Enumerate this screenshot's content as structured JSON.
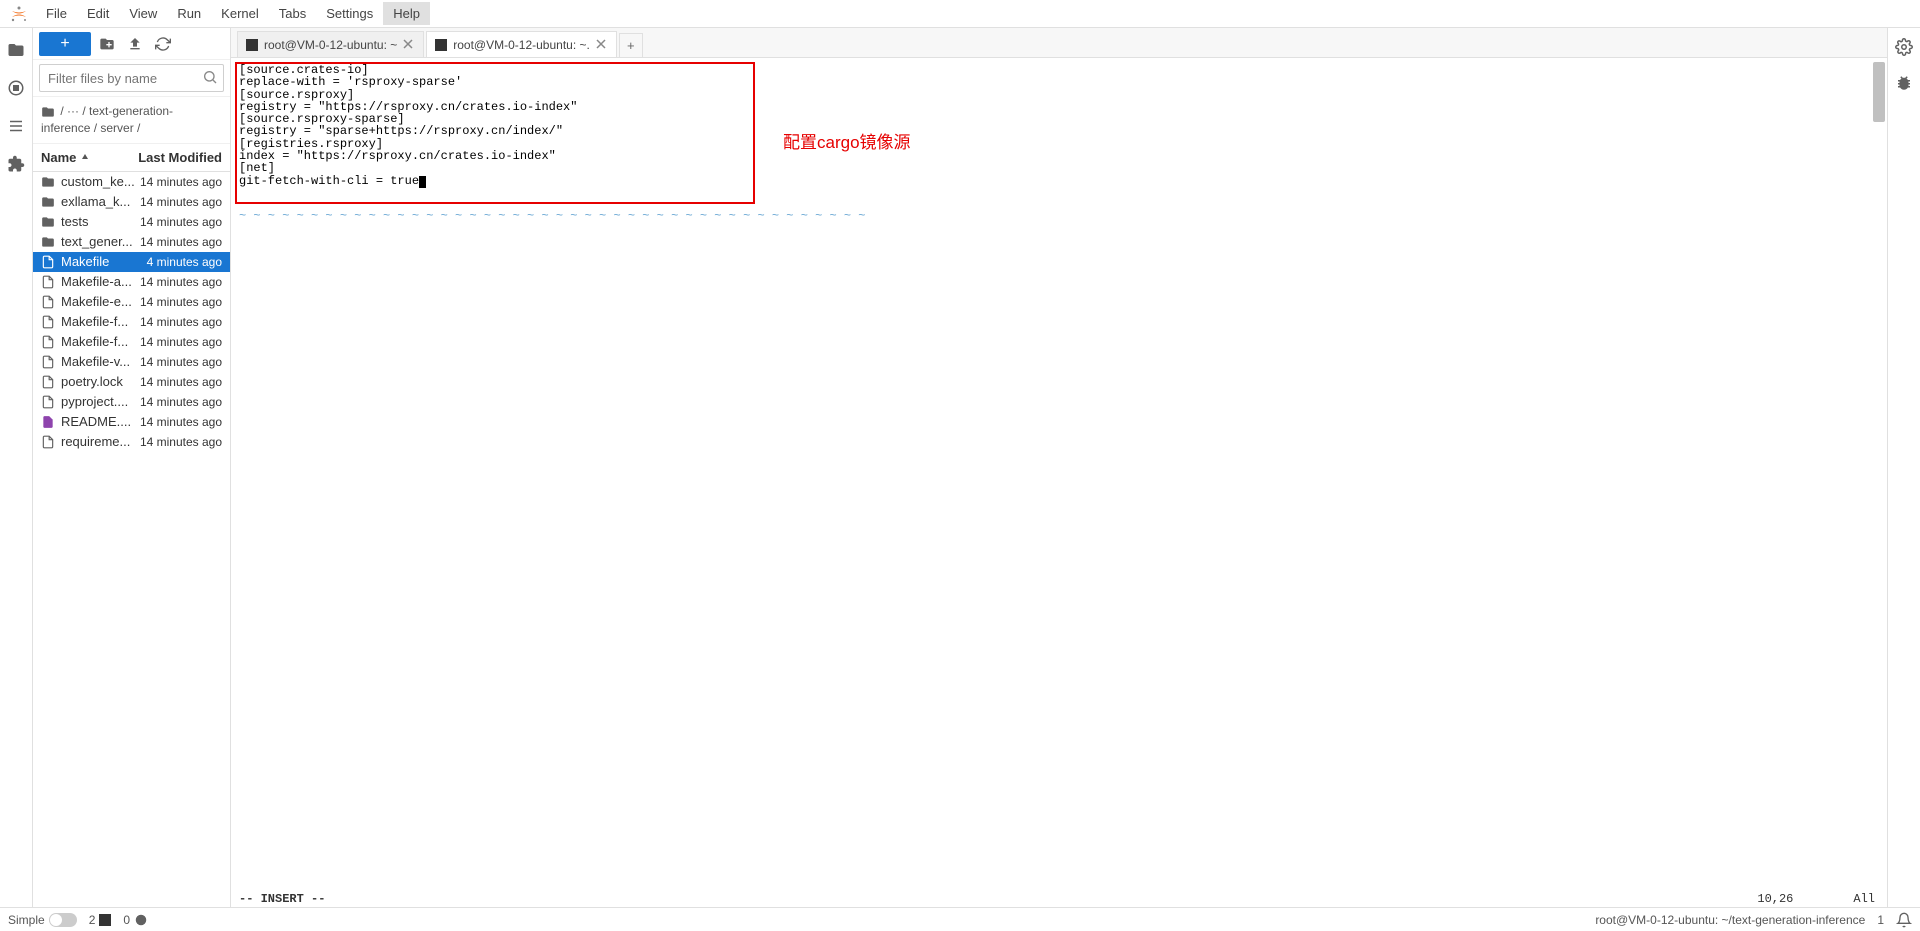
{
  "menu": {
    "items": [
      "File",
      "Edit",
      "View",
      "Run",
      "Kernel",
      "Tabs",
      "Settings",
      "Help"
    ],
    "active_index": 7
  },
  "filter": {
    "placeholder": "Filter files by name"
  },
  "breadcrumb": {
    "text": " /  ···  / text-generation-inference / server /"
  },
  "file_header": {
    "name_label": "Name",
    "modified_label": "Last Modified"
  },
  "files": [
    {
      "icon": "folder",
      "name": "custom_ke...",
      "time": "14 minutes ago",
      "sel": false
    },
    {
      "icon": "folder",
      "name": "exllama_k...",
      "time": "14 minutes ago",
      "sel": false
    },
    {
      "icon": "folder",
      "name": "tests",
      "time": "14 minutes ago",
      "sel": false
    },
    {
      "icon": "folder",
      "name": "text_gener...",
      "time": "14 minutes ago",
      "sel": false
    },
    {
      "icon": "file",
      "name": "Makefile",
      "time": "4 minutes ago",
      "sel": true
    },
    {
      "icon": "file",
      "name": "Makefile-a...",
      "time": "14 minutes ago",
      "sel": false
    },
    {
      "icon": "file",
      "name": "Makefile-e...",
      "time": "14 minutes ago",
      "sel": false
    },
    {
      "icon": "file",
      "name": "Makefile-f...",
      "time": "14 minutes ago",
      "sel": false
    },
    {
      "icon": "file",
      "name": "Makefile-f...",
      "time": "14 minutes ago",
      "sel": false
    },
    {
      "icon": "file",
      "name": "Makefile-v...",
      "time": "14 minutes ago",
      "sel": false
    },
    {
      "icon": "file",
      "name": "poetry.lock",
      "time": "14 minutes ago",
      "sel": false
    },
    {
      "icon": "file",
      "name": "pyproject....",
      "time": "14 minutes ago",
      "sel": false
    },
    {
      "icon": "markdown",
      "name": "README....",
      "time": "14 minutes ago",
      "sel": false
    },
    {
      "icon": "file",
      "name": "requireme...",
      "time": "14 minutes ago",
      "sel": false
    }
  ],
  "tabs": [
    {
      "label": "root@VM-0-12-ubuntu: ~",
      "active": false,
      "closable": true
    },
    {
      "label": "root@VM-0-12-ubuntu: ~.",
      "active": true,
      "closable": true
    }
  ],
  "terminal": {
    "lines": "[source.crates-io]\nreplace-with = 'rsproxy-sparse'\n[source.rsproxy]\nregistry = \"https://rsproxy.cn/crates.io-index\"\n[source.rsproxy-sparse]\nregistry = \"sparse+https://rsproxy.cn/index/\"\n[registries.rsproxy]\nindex = \"https://rsproxy.cn/crates.io-index\"\n[net]\ngit-fetch-with-cli = true",
    "annotation": "配置cargo镜像源",
    "vim_mode": "-- INSERT --",
    "vim_pos": "10,26",
    "vim_all": "All"
  },
  "statusbar": {
    "simple_label": "Simple",
    "count1": "2",
    "count2": "0",
    "path": "root@VM-0-12-ubuntu: ~/text-generation-inference",
    "num": "1"
  }
}
